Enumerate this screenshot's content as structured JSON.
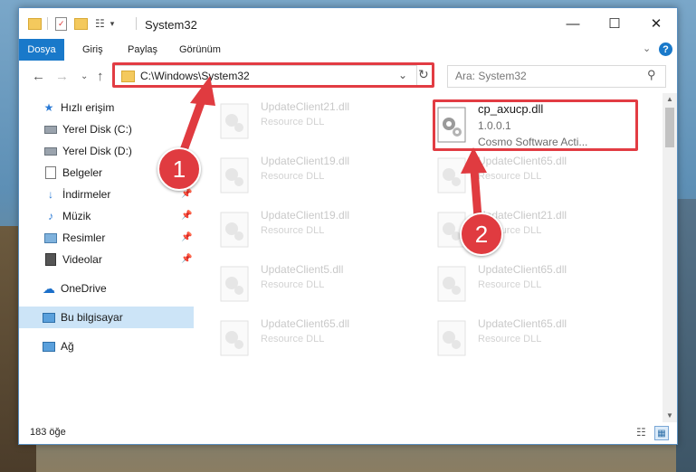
{
  "window": {
    "title": "System32",
    "controls": {
      "minimize": "—",
      "maximize": "☐",
      "close": "✕"
    }
  },
  "ribbon": {
    "file_tab": "Dosya",
    "tabs": [
      "Giriş",
      "Paylaş",
      "Görünüm"
    ]
  },
  "address": {
    "path": "C:\\Windows\\System32",
    "search_placeholder": "Ara: System32"
  },
  "sidebar": {
    "items": [
      {
        "label": "Hızlı erişim",
        "icon": "star-icon"
      },
      {
        "label": "Yerel Disk (C:)",
        "icon": "drive-icon"
      },
      {
        "label": "Yerel Disk (D:)",
        "icon": "drive-icon"
      },
      {
        "label": "Belgeler",
        "icon": "documents-icon"
      },
      {
        "label": "İndirmeler",
        "icon": "download-icon"
      },
      {
        "label": "Müzik",
        "icon": "music-icon"
      },
      {
        "label": "Resimler",
        "icon": "pictures-icon"
      },
      {
        "label": "Videolar",
        "icon": "video-icon"
      },
      {
        "label": "OneDrive",
        "icon": "cloud-icon"
      },
      {
        "label": "Bu bilgisayar",
        "icon": "computer-icon"
      },
      {
        "label": "Ağ",
        "icon": "network-icon"
      }
    ]
  },
  "files": {
    "left": [
      {
        "name": "UpdateClient21.dll",
        "type": "Resource DLL"
      },
      {
        "name": "UpdateClient19.dll",
        "type": "Resource DLL"
      },
      {
        "name": "UpdateClient19.dll",
        "type": "Resource DLL"
      },
      {
        "name": "UpdateClient5.dll",
        "type": "Resource DLL"
      },
      {
        "name": "UpdateClient65.dll",
        "type": "Resource DLL"
      }
    ],
    "focused": {
      "name": "cp_axucp.dll",
      "version": "1.0.0.1",
      "company": "Cosmo Software Acti..."
    },
    "right": [
      {
        "name": "UpdateClient65.dll",
        "type": "Resource DLL"
      },
      {
        "name": "UpdateClient21.dll",
        "type": "Resource DLL"
      },
      {
        "name": "UpdateClient65.dll",
        "type": "Resource DLL"
      },
      {
        "name": "UpdateClient65.dll",
        "type": "Resource DLL"
      }
    ]
  },
  "status": {
    "count": "183 öğe"
  },
  "callouts": {
    "one": "1",
    "two": "2"
  },
  "colors": {
    "accent": "#1979ca",
    "highlight": "#e23c43",
    "selected": "#cce4f7"
  }
}
